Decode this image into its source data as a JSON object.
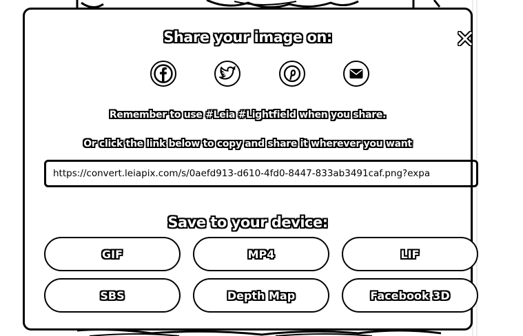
{
  "modal": {
    "title": "Share your image on:",
    "close_icon": "close-icon",
    "social_icons": [
      "facebook-icon",
      "twitter-icon",
      "pinterest-icon",
      "email-icon"
    ],
    "reminder": "Remember to use #Leia #Lightfield when you share.",
    "copy_hint": "Or click the link below to copy and share it wherever you want",
    "share_link": "https://convert.leiapix.com/s/0aefd913-d610-4fd0-8447-833ab3491caf.png?expa",
    "save_title": "Save to your device:",
    "buttons": {
      "gif": "GIF",
      "mp4": "MP4",
      "lif": "LIF",
      "sbs": "SBS",
      "depth_map": "Depth Map",
      "facebook_3d": "Facebook 3D"
    }
  }
}
